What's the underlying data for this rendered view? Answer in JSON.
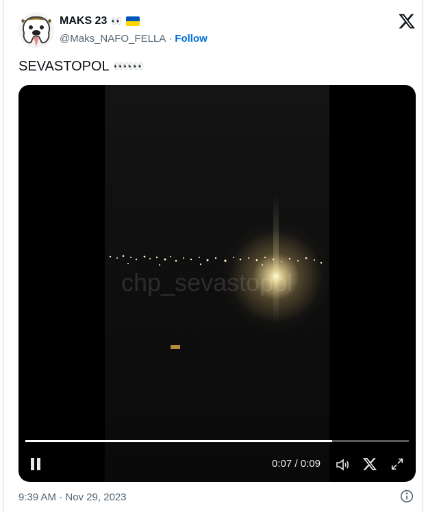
{
  "author": {
    "display_name": "MAKS 23",
    "name_emoji": "👀",
    "handle": "@Maks_NAFO_FELLA",
    "separator": "·",
    "follow_label": "Follow"
  },
  "tweet": {
    "text": "SEVASTOPOL",
    "text_emoji": "👀👀👀"
  },
  "video": {
    "watermark": "chp_sevastopol",
    "current_time": "0:07",
    "time_separator": "/",
    "duration": "0:09",
    "progress_fraction": 0.8
  },
  "footer": {
    "timestamp": "9:39 AM · Nov 29, 2023"
  },
  "icons": {
    "logo": "x-logo-icon",
    "pause": "pause-icon",
    "volume": "volume-icon",
    "x_small": "x-logo-small-icon",
    "fullscreen": "fullscreen-icon",
    "info": "info-icon"
  },
  "colors": {
    "follow": "#006fd6",
    "secondary_text": "#536471",
    "flag_blue": "#0057b7",
    "flag_yellow": "#ffd700"
  }
}
